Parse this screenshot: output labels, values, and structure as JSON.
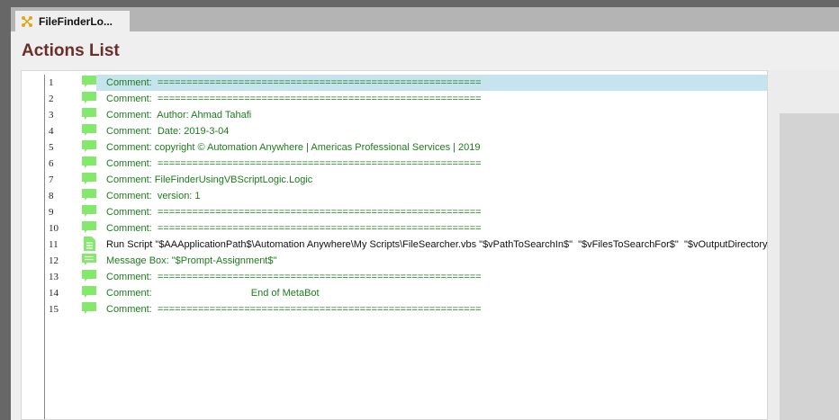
{
  "tab": {
    "label": "FileFinderLo..."
  },
  "title": "Actions List",
  "actions": [
    {
      "n": "1",
      "icon": "comment-icon",
      "text": "Comment:  ========================================================",
      "sel": true
    },
    {
      "n": "2",
      "icon": "comment-icon",
      "text": "Comment:  ========================================================"
    },
    {
      "n": "3",
      "icon": "comment-icon",
      "text": "Comment:  Author: Ahmad Tahafi"
    },
    {
      "n": "4",
      "icon": "comment-icon",
      "text": "Comment:  Date: 2019-3-04"
    },
    {
      "n": "5",
      "icon": "comment-icon",
      "text": "Comment: copyright © Automation Anywhere | Americas Professional Services | 2019"
    },
    {
      "n": "6",
      "icon": "comment-icon",
      "text": "Comment:  ========================================================"
    },
    {
      "n": "7",
      "icon": "comment-icon",
      "text": "Comment: FileFinderUsingVBScriptLogic.Logic"
    },
    {
      "n": "8",
      "icon": "comment-icon",
      "text": "Comment:  version: 1"
    },
    {
      "n": "9",
      "icon": "comment-icon",
      "text": "Comment:  ========================================================"
    },
    {
      "n": "10",
      "icon": "comment-icon",
      "text": "Comment:  ========================================================"
    },
    {
      "n": "11",
      "icon": "script-icon",
      "text": "Run Script \"$AAApplicationPath$\\Automation Anywhere\\My Scripts\\FileSearcher.vbs \"$vPathToSearchIn$\"  \"$vFilesToSearchFor$\"  \"$vOutputDirectory$\"",
      "black": true
    },
    {
      "n": "12",
      "icon": "message-box-icon",
      "text": "Message Box: \"$Prompt-Assignment$\""
    },
    {
      "n": "13",
      "icon": "comment-icon",
      "text": "Comment:  ========================================================"
    },
    {
      "n": "14",
      "icon": "comment-icon",
      "text": "Comment:                                    End of MetaBot"
    },
    {
      "n": "15",
      "icon": "comment-icon",
      "text": "Comment:  ========================================================"
    }
  ]
}
